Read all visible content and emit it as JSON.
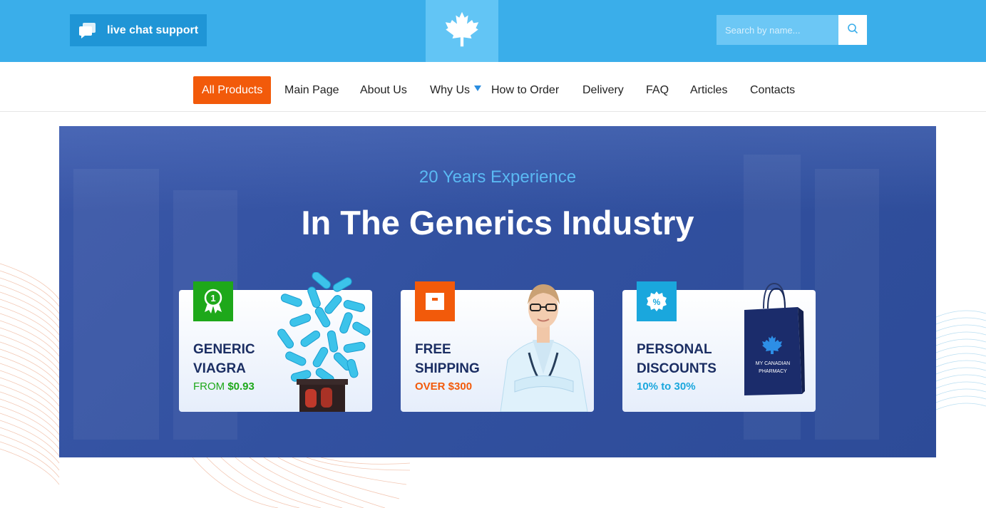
{
  "header": {
    "chat_label": "live chat support",
    "search_placeholder": "Search by name..."
  },
  "nav": {
    "items": [
      {
        "label": "All Products"
      },
      {
        "label": "Main Page"
      },
      {
        "label": "About Us"
      },
      {
        "label": "Why Us"
      },
      {
        "label": "How to Order"
      },
      {
        "label": "Delivery"
      },
      {
        "label": "FAQ"
      },
      {
        "label": "Articles"
      },
      {
        "label": "Contacts"
      }
    ]
  },
  "hero": {
    "subtitle": "20 Years Experience",
    "title": "In The Generics Industry"
  },
  "cards": [
    {
      "title_line1": "GENERIC",
      "title_line2": "VIAGRA",
      "sub_prefix": "FROM ",
      "sub_value": "$0.93",
      "accent": "#1ea81a"
    },
    {
      "title_line1": "FREE",
      "title_line2": "SHIPPING",
      "sub_prefix": "",
      "sub_value": "OVER $300",
      "accent": "#f25a0a"
    },
    {
      "title_line1": "PERSONAL",
      "title_line2": "DISCOUNTS",
      "sub_prefix": "",
      "sub_value": "10% to 30%",
      "accent": "#1aa7dd"
    }
  ],
  "bag": {
    "line1": "MY CANADIAN",
    "line2": "PHARMACY"
  },
  "colors": {
    "header_bg": "#3aaeea",
    "active_nav": "#f25a0a",
    "hero_bg": "#3251a0",
    "card_title": "#1b2e63"
  },
  "icons": {
    "chat": "chat-bubbles-icon",
    "logo": "maple-leaf-icon",
    "search": "search-icon",
    "caret": "caret-down-icon",
    "award": "award-ribbon-icon",
    "box": "package-box-icon",
    "percent": "percent-badge-icon"
  }
}
